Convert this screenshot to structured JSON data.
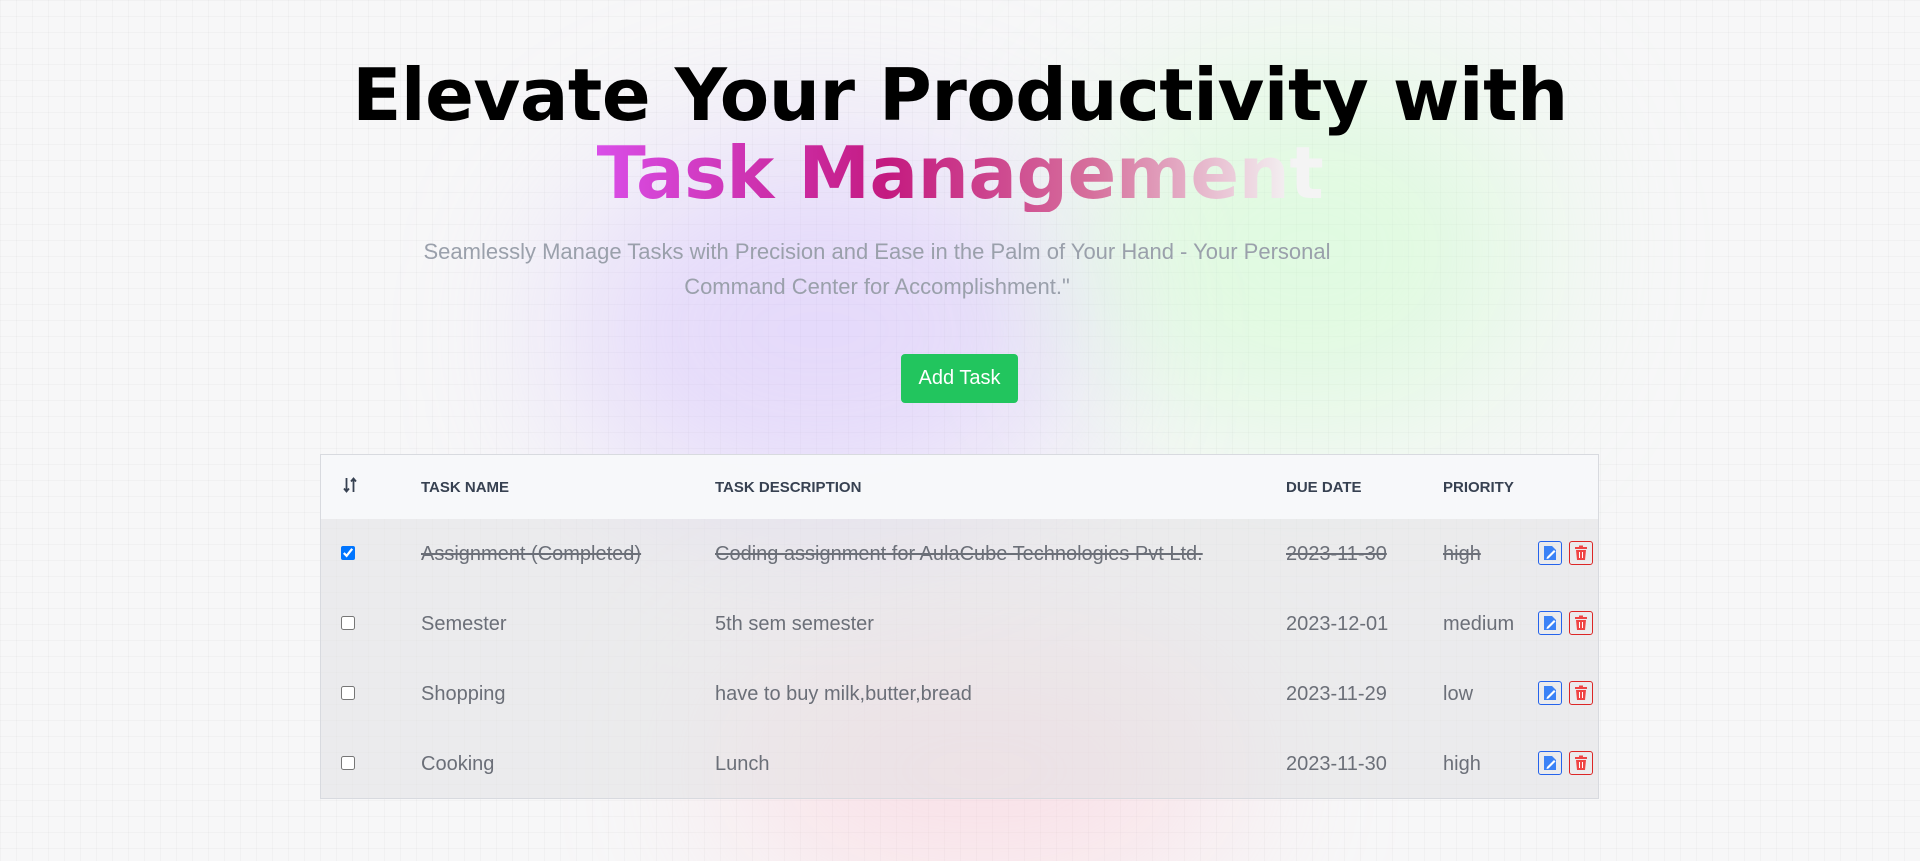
{
  "hero": {
    "headline_line1": "Elevate Your Productivity with",
    "headline_accent": "Task Management",
    "subtitle": "Seamlessly Manage Tasks with Precision and Ease in the Palm of Your Hand - Your Personal Command Center for Accomplishment.\"",
    "add_button": "Add Task"
  },
  "table": {
    "sort_icon": "sort-icon",
    "columns": [
      "TASK NAME",
      "TASK DESCRIPTION",
      "DUE DATE",
      "PRIORITY"
    ],
    "rows": [
      {
        "completed": true,
        "name": "Assignment (Completed)",
        "description": "Coding assignment for AulaCube Technologies Pvt Ltd.",
        "due": "2023-11-30",
        "priority": "high"
      },
      {
        "completed": false,
        "name": "Semester",
        "description": "5th sem semester",
        "due": "2023-12-01",
        "priority": "medium"
      },
      {
        "completed": false,
        "name": "Shopping",
        "description": "have to buy milk,butter,bread",
        "due": "2023-11-29",
        "priority": "low"
      },
      {
        "completed": false,
        "name": "Cooking",
        "description": "Lunch",
        "due": "2023-11-30",
        "priority": "high"
      }
    ],
    "row_actions": [
      "edit-icon",
      "delete-icon"
    ]
  },
  "colors": {
    "accent_green": "#22c55e",
    "edit_blue": "#2563eb",
    "delete_red": "#dc2626",
    "headline_gradient": [
      "#d94ee8",
      "#c41a80",
      "#d66f9c"
    ]
  }
}
